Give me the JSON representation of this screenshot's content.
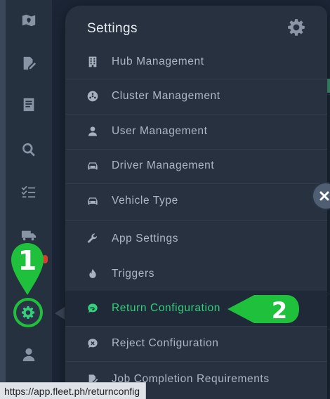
{
  "sidebar": {
    "icons": [
      "map-icon",
      "edit-document-icon",
      "receipt-icon",
      "search-icon",
      "checklist-icon",
      "truck-icon",
      "gear-icon",
      "user-icon"
    ]
  },
  "panel": {
    "title": "Settings",
    "items": [
      {
        "label": "Hub Management",
        "icon": "building-icon"
      },
      {
        "label": "Cluster Management",
        "icon": "cluster-icon"
      },
      {
        "label": "User Management",
        "icon": "user-icon"
      },
      {
        "label": "Driver Management",
        "icon": "car-icon"
      },
      {
        "label": "Vehicle Type",
        "icon": "car-icon"
      },
      {
        "label": "App Settings",
        "icon": "wrench-icon"
      },
      {
        "label": "Triggers",
        "icon": "flame-icon"
      },
      {
        "label": "Return Configuration",
        "icon": "return-chat-icon",
        "active": true
      },
      {
        "label": "Reject Configuration",
        "icon": "reject-chat-icon"
      },
      {
        "label": "Job Completion Requirements",
        "icon": "edit-document-icon"
      }
    ]
  },
  "annotations": {
    "step1": "1",
    "step2": "2",
    "color": "#1fc13c"
  },
  "colors": {
    "accent": "#34d17c",
    "panel": "#27313f",
    "sidebar": "#26313f"
  },
  "status_bar": {
    "url": "https://app.fleet.ph/returnconfig"
  }
}
